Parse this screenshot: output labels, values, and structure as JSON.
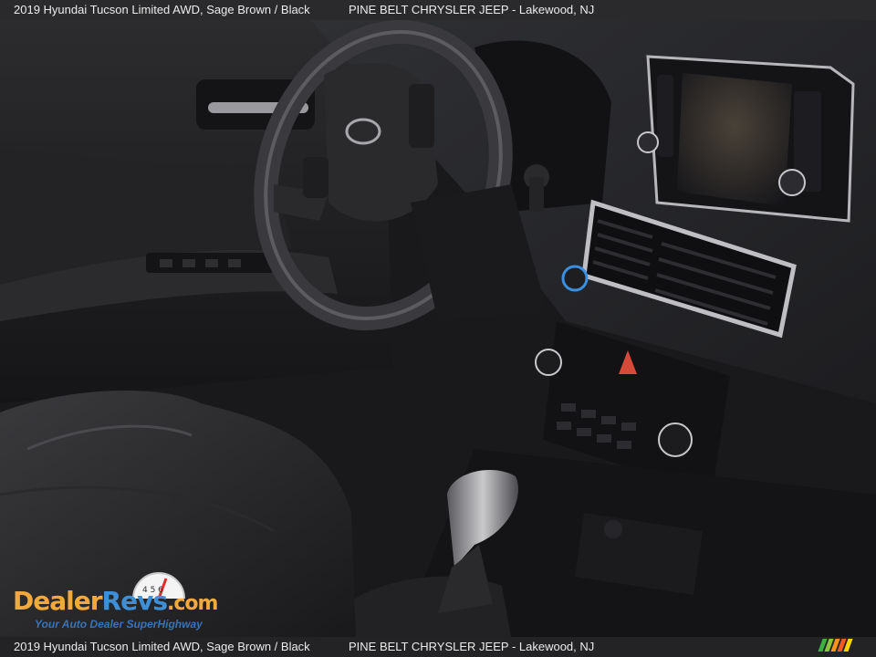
{
  "caption": {
    "vehicle": "2019 Hyundai Tucson Limited AWD,  Sage Brown / Black",
    "dealer": "PINE BELT CHRYSLER JEEP - Lakewood, NJ"
  },
  "watermark": {
    "brand_part1": "Dealer",
    "brand_part2": "Revs",
    "brand_part3": ".com",
    "tagline": "Your Auto Dealer SuperHighway",
    "gauge_digits": "4 5 6"
  },
  "stripe_colors": [
    "#3cb043",
    "#8cc63f",
    "#f7941d",
    "#f15a24",
    "#ffd400"
  ],
  "colors": {
    "interior_dark": "#1c1c1e",
    "bar_background": "#2a2a2c",
    "bar_text": "#ececec",
    "brand_orange": "#f2a93b",
    "brand_blue": "#3f8fd6"
  }
}
